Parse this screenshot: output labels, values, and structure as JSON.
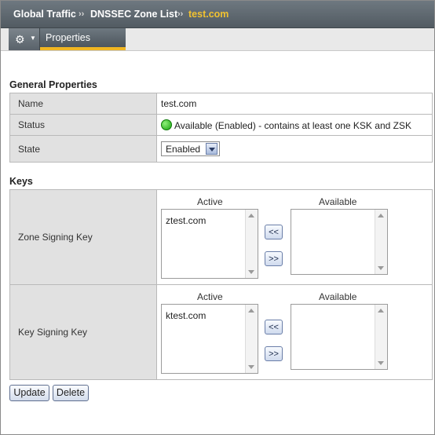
{
  "breadcrumb": {
    "items": [
      "Global Traffic",
      "DNSSEC Zone List",
      "test.com"
    ],
    "separator": "››"
  },
  "tabs": {
    "gear_icon": "gear-icon",
    "active_tab": "Properties"
  },
  "general": {
    "title": "General Properties",
    "rows": [
      {
        "label": "Name",
        "value": "test.com"
      },
      {
        "label": "Status",
        "value": "Available (Enabled) - contains at least one KSK and ZSK",
        "status_color": "#18a30e"
      },
      {
        "label": "State",
        "value": "Enabled"
      }
    ]
  },
  "keys": {
    "title": "Keys",
    "active_header": "Active",
    "available_header": "Available",
    "move_left_label": "<<",
    "move_right_label": ">>",
    "rows": [
      {
        "label": "Zone Signing Key",
        "active": [
          "ztest.com"
        ],
        "available": []
      },
      {
        "label": "Key Signing Key",
        "active": [
          "ktest.com"
        ],
        "available": []
      }
    ]
  },
  "actions": {
    "update_label": "Update",
    "delete_label": "Delete"
  },
  "colors": {
    "header_bg": "#5f6970",
    "breadcrumb_current": "#f2c230",
    "tab_underline": "#f1b621",
    "label_cell_bg": "#e1e1e1"
  }
}
